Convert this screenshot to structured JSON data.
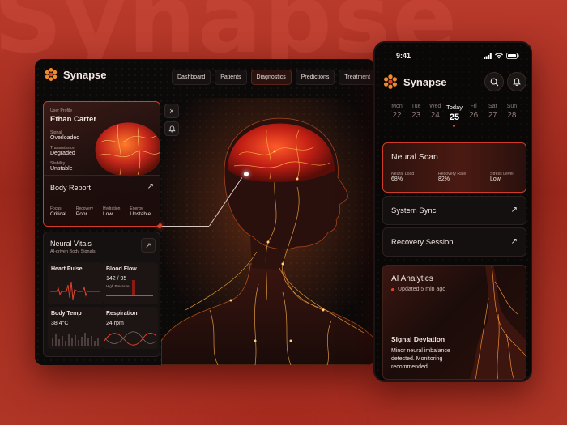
{
  "background": {
    "watermark": "Synapse"
  },
  "colors": {
    "accent": "#e0432c",
    "brand_orange": "#f39a2d",
    "card_border_active": "#d63a2a"
  },
  "app": {
    "name": "Synapse"
  },
  "nav": {
    "tabs": [
      "Dashboard",
      "Patients",
      "Diagnostics",
      "Predictions",
      "Treatment"
    ],
    "active": "Diagnostics"
  },
  "profile": {
    "header": "User Profile",
    "name": "Ethan Carter",
    "stats": [
      {
        "label": "Signal",
        "value": "Overloaded"
      },
      {
        "label": "Transmission",
        "value": "Degraded"
      },
      {
        "label": "Stability",
        "value": "Unstable"
      }
    ],
    "report_title": "Body Report",
    "metrics": [
      {
        "label": "Focus",
        "value": "Critical"
      },
      {
        "label": "Recovery",
        "value": "Poor"
      },
      {
        "label": "Hydration",
        "value": "Low"
      },
      {
        "label": "Energy",
        "value": "Unstable"
      }
    ]
  },
  "side_buttons": {
    "close": "×",
    "notify_icon": "bell-icon"
  },
  "vitals": {
    "title": "Neural Vitals",
    "subtitle": "AI-driven Body Signals",
    "heart_pulse": {
      "title": "Heart Pulse"
    },
    "blood_flow": {
      "title": "Blood Flow",
      "value": "142 / 95",
      "tag": "High Pressure"
    },
    "body_temp": {
      "title": "Body Temp",
      "value": "38.4°C"
    },
    "respiration": {
      "title": "Respiration",
      "value": "24 rpm"
    }
  },
  "phone": {
    "time": "9:41",
    "app_name": "Synapse",
    "calendar": [
      {
        "day": "Mon",
        "date": "22"
      },
      {
        "day": "Tue",
        "date": "23"
      },
      {
        "day": "Wed",
        "date": "24"
      },
      {
        "day": "Today",
        "date": "25",
        "today": true
      },
      {
        "day": "Fri",
        "date": "26"
      },
      {
        "day": "Sat",
        "date": "27"
      },
      {
        "day": "Sun",
        "date": "28"
      }
    ],
    "neural_scan": {
      "title": "Neural Scan",
      "stats": [
        {
          "label": "Neural Load",
          "value": "68%"
        },
        {
          "label": "Recovery Rate",
          "value": "82%"
        },
        {
          "label": "Stress Level",
          "value": "Low"
        }
      ]
    },
    "system_sync": "System Sync",
    "recovery_session": "Recovery Session",
    "analytics": {
      "title": "AI Analytics",
      "updated": "Updated 5 min ago",
      "deviation_title": "Signal Deviation",
      "deviation_text": "Minor neural imbalance detected. Monitoring recommended."
    }
  }
}
